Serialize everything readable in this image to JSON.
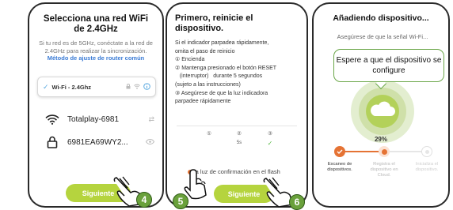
{
  "screen1": {
    "title": "Selecciona una red WiFi de 2.4GHz",
    "body_text": "Si tu red es de 5GHz, conéctate a la red de 2.4GHz para realizar la sincronización.",
    "link_text": "Método de ajuste de router común",
    "selected_network": {
      "ssid": "Wi-Fi - 2.4Ghz"
    },
    "networks": [
      {
        "name": "Totalplay-6981",
        "icon": "wifi-icon"
      },
      {
        "name": "6981EA69WY2...",
        "icon": "lock-icon"
      }
    ],
    "next_button": "Siguiente"
  },
  "screen2": {
    "title": "Primero, reinicie el dispositivo.",
    "instructions": [
      "Si el indicador parpadea rápidamente,",
      "omita el paso de reinicio",
      "① Encienda",
      "② Mantenga presionado el botón RESET",
      "   (interruptor)   durante 5 segundos",
      "(sujeto a las instrucciones)",
      "③ Asegúrese de que la luz indicadora",
      "parpadee rápidamente"
    ],
    "step_icons": [
      "①",
      "②",
      "③"
    ],
    "step_sub": [
      "",
      "5s",
      "✓"
    ],
    "confirm_label": "la luz de confirmación en el flash",
    "next_button": "Siguiente"
  },
  "screen3": {
    "title": "Añadiendo dispositivo...",
    "subtitle": "Asegúrese de que la señal Wi-Fi...",
    "tooltip": "Espere a que el dispositivo se configure",
    "progress_percent": "29%",
    "progress_value": 0.29,
    "steps": [
      {
        "label": "Escaneo de dispositivos.",
        "state": "done"
      },
      {
        "label": "Registra el dispositivo en Cloud.",
        "state": "active"
      },
      {
        "label": "Inicializa el dispositivo.",
        "state": "pending"
      }
    ]
  },
  "badges": [
    "4",
    "5",
    "6"
  ],
  "colors": {
    "green": "#b5d43e",
    "orange": "#e57334",
    "badge": "#6aa13c",
    "link": "#3a7bd5"
  }
}
